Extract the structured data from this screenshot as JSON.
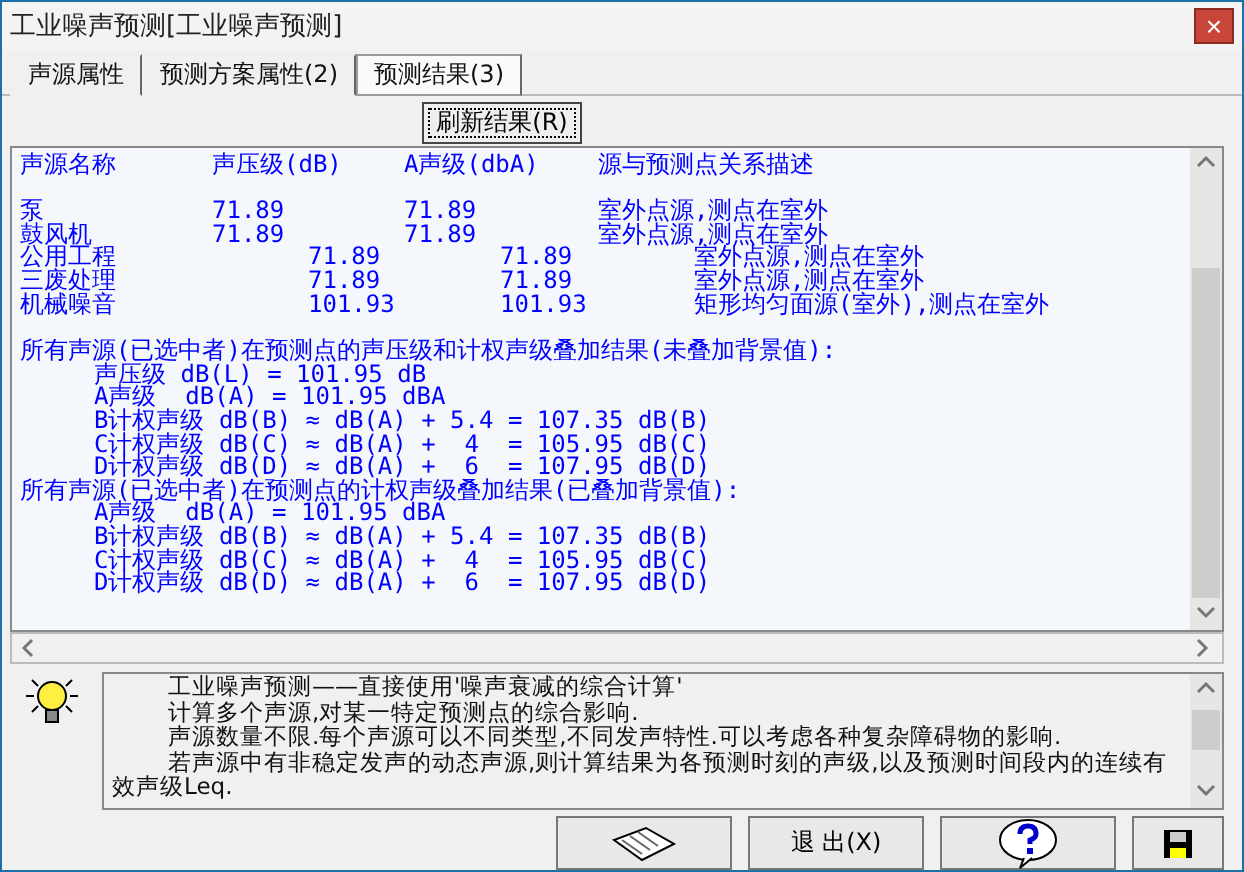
{
  "window": {
    "title": "工业噪声预测[工业噪声预测]",
    "close": "×"
  },
  "tabs": [
    {
      "label": "声源属性",
      "selected": false
    },
    {
      "label": "预测方案属性(2)",
      "selected": false
    },
    {
      "label": "预测结果(3)",
      "selected": true
    }
  ],
  "refresh_button": "刷新结果(R)",
  "results": {
    "columns": [
      "声源名称",
      "声压级(dB)",
      "A声级(dbA)",
      "源与预测点关系描述"
    ],
    "rows": [
      {
        "kind": "aligned",
        "cells": [
          "泵",
          "71.89",
          "71.89",
          "室外点源,测点在室外"
        ]
      },
      {
        "kind": "aligned",
        "cells": [
          "鼓风机",
          "71.89",
          "71.89",
          "室外点源,测点在室外"
        ]
      },
      {
        "kind": "shifted",
        "cells": [
          "公用工程",
          "71.89",
          "71.89",
          "室外点源,测点在室外"
        ]
      },
      {
        "kind": "shifted",
        "cells": [
          "三废处理",
          "71.89",
          "71.89",
          "室外点源,测点在室外"
        ]
      },
      {
        "kind": "shifted",
        "cells": [
          "机械噪音",
          "101.93",
          "101.93",
          "矩形均匀面源(室外),测点在室外"
        ]
      }
    ],
    "summaries": [
      {
        "heading": "所有声源(已选中者)在预测点的声压级和计权声级叠加结果(未叠加背景值):",
        "lines": [
          "声压级 dB(L) = 101.95 dB",
          "A声级  dB(A) = 101.95 dBA",
          "B计权声级 dB(B) ≈ dB(A) + 5.4 = 107.35 dB(B)",
          "C计权声级 dB(C) ≈ dB(A) +  4  = 105.95 dB(C)",
          "D计权声级 dB(D) ≈ dB(A) +  6  = 107.95 dB(D)"
        ]
      },
      {
        "heading": "所有声源(已选中者)在预测点的计权声级叠加结果(已叠加背景值):",
        "lines": [
          "A声级  dB(A) = 101.95 dBA",
          "B计权声级 dB(B) ≈ dB(A) + 5.4 = 107.35 dB(B)",
          "C计权声级 dB(C) ≈ dB(A) +  4  = 105.95 dB(C)",
          "D计权声级 dB(D) ≈ dB(A) +  6  = 107.95 dB(D)"
        ]
      }
    ]
  },
  "help": {
    "paragraphs": [
      "工业噪声预测——直接使用'噪声衰减的综合计算'",
      "计算多个声源,对某一特定预测点的综合影响.",
      "声源数量不限.每个声源可以不同类型,不同发声特性.可以考虑各种复杂障碍物的影响.",
      "若声源中有非稳定发声的动态声源,则计算结果为各预测时刻的声级,以及预测时间段内的连续有效声级Leq."
    ]
  },
  "buttons": [
    {
      "kind": "book"
    },
    {
      "kind": "text",
      "label": "退 出(X)"
    },
    {
      "kind": "help"
    },
    {
      "kind": "save"
    }
  ]
}
